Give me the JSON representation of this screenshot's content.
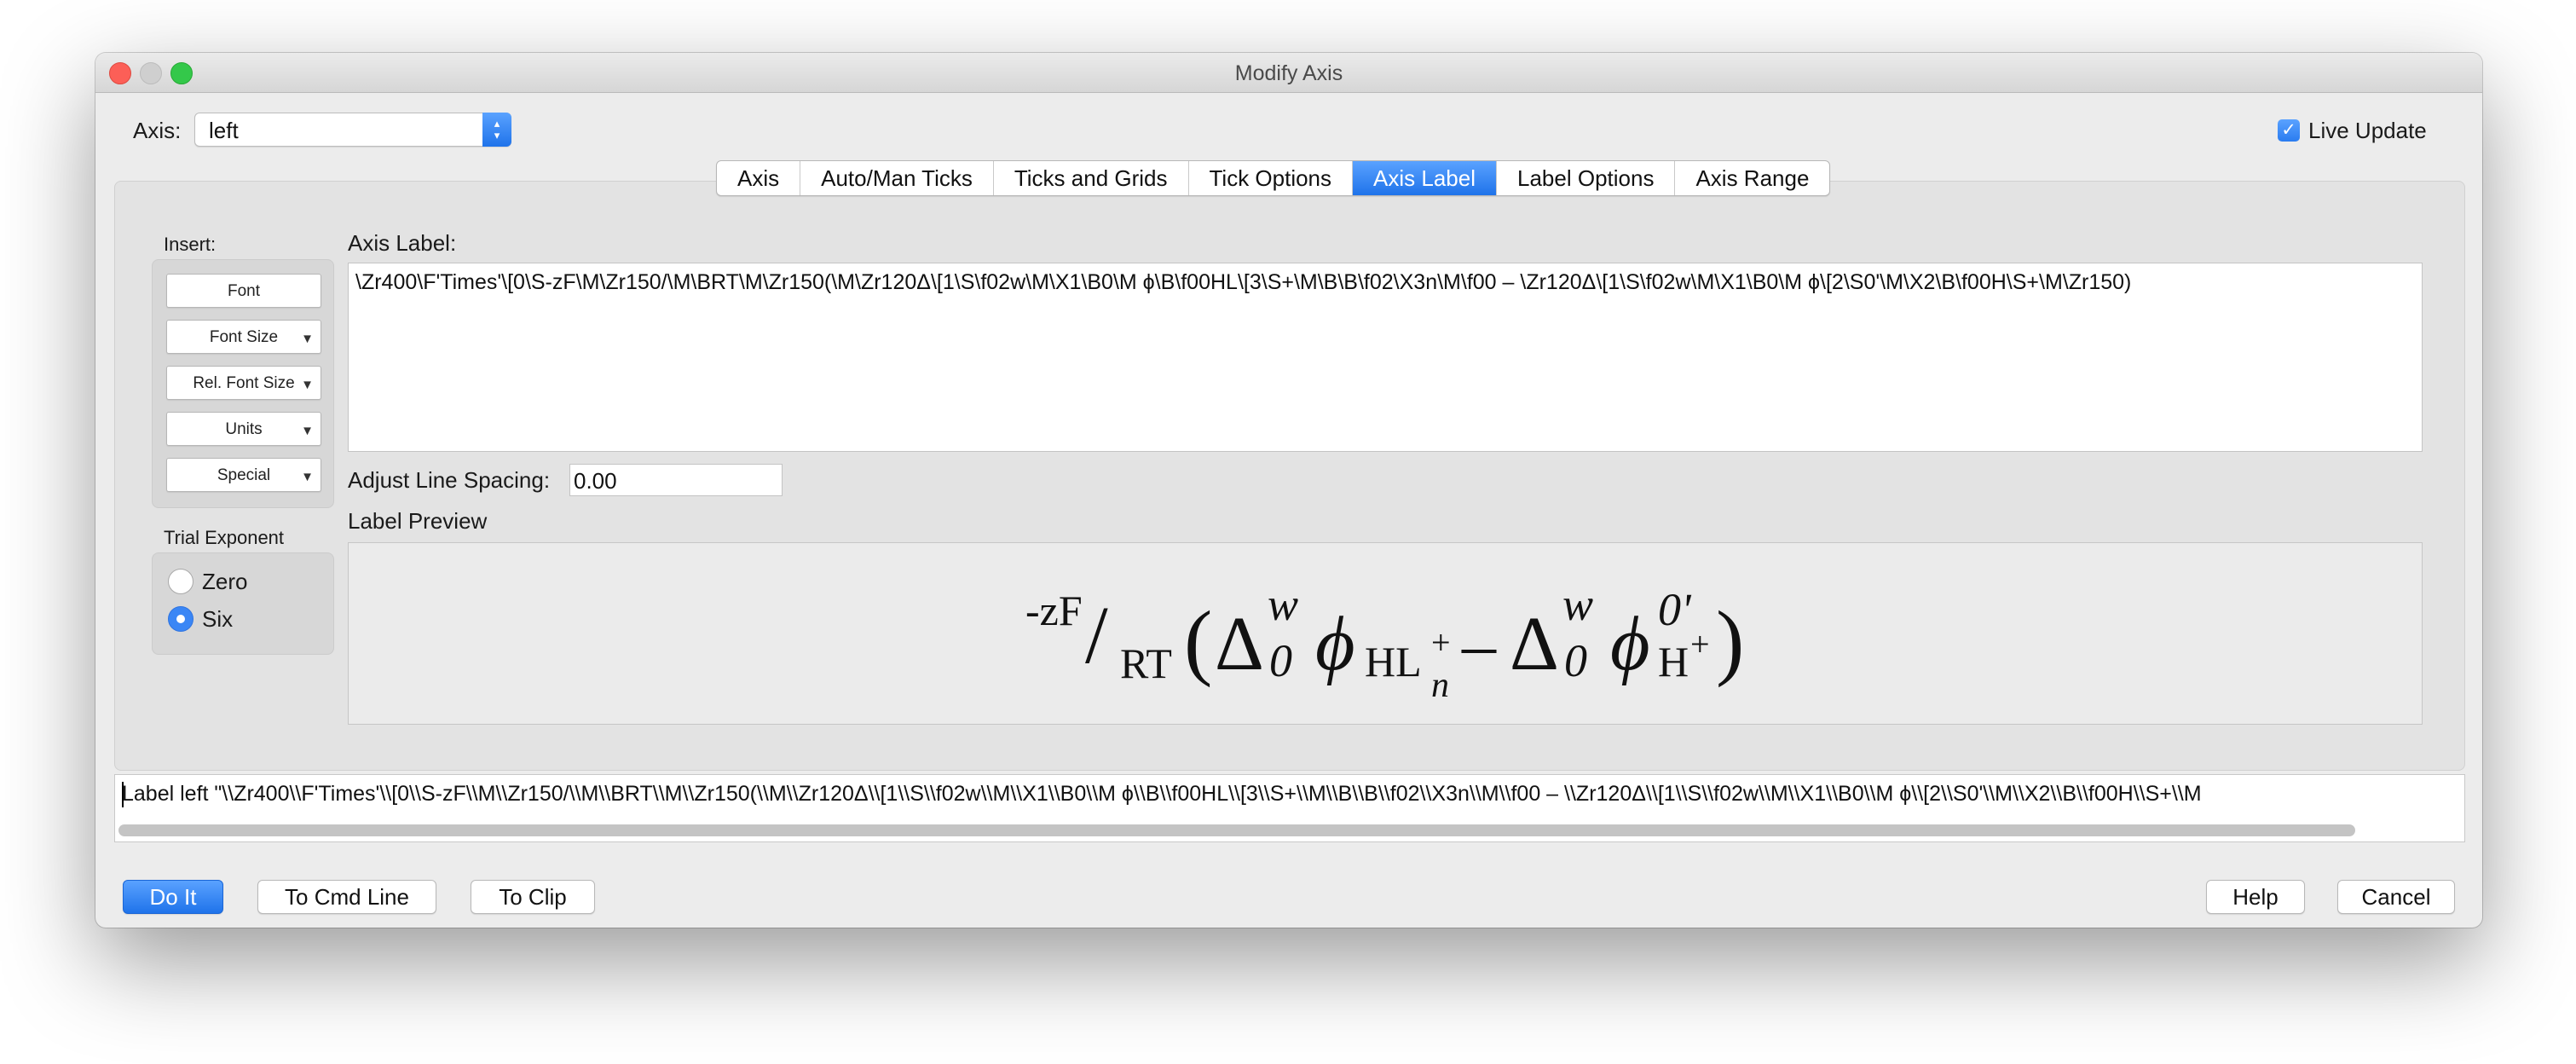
{
  "window": {
    "title": "Modify Axis"
  },
  "axis": {
    "label": "Axis:",
    "value": "left"
  },
  "live_update": {
    "label": "Live Update",
    "checked": true
  },
  "tabs": [
    {
      "label": "Axis",
      "active": false
    },
    {
      "label": "Auto/Man Ticks",
      "active": false
    },
    {
      "label": "Ticks and Grids",
      "active": false
    },
    {
      "label": "Tick Options",
      "active": false
    },
    {
      "label": "Axis Label",
      "active": true
    },
    {
      "label": "Label Options",
      "active": false
    },
    {
      "label": "Axis Range",
      "active": false
    }
  ],
  "insert": {
    "title": "Insert:",
    "buttons": [
      "Font",
      "Font Size",
      "Rel. Font Size",
      "Units",
      "Special"
    ]
  },
  "trial_exponent": {
    "title": "Trial Exponent",
    "options": [
      "Zero",
      "Six"
    ],
    "selected": "Six"
  },
  "axis_label": {
    "title": "Axis Label:",
    "text": "\\Zr400\\F'Times'\\[0\\S-zF\\M\\Zr150/\\M\\BRT\\M\\Zr150(\\M\\Zr120Δ\\[1\\S\\f02w\\M\\X1\\B0\\M ϕ\\B\\f00HL\\[3\\S+\\M\\B\\B\\f02\\X3n\\M\\f00 – \\Zr120Δ\\[1\\S\\f02w\\M\\X1\\B0\\M ϕ\\[2\\S0'\\M\\X2\\B\\f00H\\S+\\M\\Zr150)"
  },
  "line_spacing": {
    "label": "Adjust Line Spacing:",
    "value": "0.00"
  },
  "preview": {
    "title": "Label Preview",
    "pre_sup": "-zF",
    "slash": "/",
    "rt": "RT",
    "open_paren": "(",
    "delta": "Δ",
    "w": "w",
    "zero": "0",
    "phi": "ϕ",
    "hl": "HL",
    "plus": "+",
    "n": "n",
    "minus": "–",
    "zero_prime": "0'",
    "h": "H",
    "close_paren": ")"
  },
  "command_line": {
    "text": "Label left \"\\\\Zr400\\\\F'Times'\\\\[0\\\\S-zF\\\\M\\\\Zr150/\\\\M\\\\BRT\\\\M\\\\Zr150(\\\\M\\\\Zr120Δ\\\\[1\\\\S\\\\f02w\\\\M\\\\X1\\\\B0\\\\M ϕ\\\\B\\\\f00HL\\\\[3\\\\S+\\\\M\\\\B\\\\B\\\\f02\\\\X3n\\\\M\\\\f00 – \\\\Zr120Δ\\\\[1\\\\S\\\\f02w\\\\M\\\\X1\\\\B0\\\\M ϕ\\\\[2\\\\S0'\\\\M\\\\X2\\\\B\\\\f00H\\\\S+\\\\M"
  },
  "buttons": {
    "do_it": "Do It",
    "to_cmd_line": "To Cmd Line",
    "to_clip": "To Clip",
    "help": "Help",
    "cancel": "Cancel"
  },
  "colors": {
    "accent": "#2a7cf0",
    "window_bg": "#ececec",
    "panel_bg": "#e3e3e3"
  }
}
